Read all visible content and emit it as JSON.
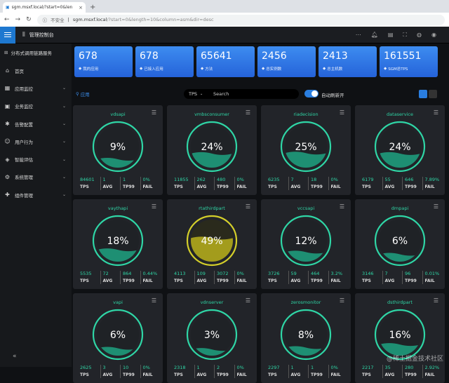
{
  "browser": {
    "tab_title": "sgm.msxf.local/?start=0&len",
    "security_label": "不安全",
    "address_host": "sgm.msxf.local",
    "address_query": "/?start=0&length=10&column=asm&dir=desc"
  },
  "header": {
    "title": "管理控制台"
  },
  "sidebar": {
    "title": "分布式调用链路服务",
    "items": [
      {
        "label": "首页",
        "icon": "home-icon",
        "has_children": false
      },
      {
        "label": "应用监控",
        "icon": "monitor-icon",
        "has_children": true
      },
      {
        "label": "业务监控",
        "icon": "business-icon",
        "has_children": true
      },
      {
        "label": "告警配置",
        "icon": "alarm-icon",
        "has_children": true
      },
      {
        "label": "用户行为",
        "icon": "user-icon",
        "has_children": true
      },
      {
        "label": "智能评估",
        "icon": "evaluate-icon",
        "has_children": true
      },
      {
        "label": "系统管理",
        "icon": "gear-icon",
        "has_children": true
      },
      {
        "label": "组件管理",
        "icon": "puzzle-icon",
        "has_children": true
      }
    ]
  },
  "stats": [
    {
      "value": "678",
      "label": "我的应用"
    },
    {
      "value": "678",
      "label": "已接入应用"
    },
    {
      "value": "65641",
      "label": "方法"
    },
    {
      "value": "2456",
      "label": "总实例数"
    },
    {
      "value": "2413",
      "label": "总主机数"
    },
    {
      "value": "161551",
      "label": "SGM总TPS"
    }
  ],
  "filter": {
    "location_label": "应用",
    "metric_select": "TPS",
    "search_placeholder": "Search",
    "auto_refresh_label": "自动刷新开",
    "auto_refresh_on": true
  },
  "metric_keys": [
    "TPS",
    "AVG",
    "TP99",
    "FAIL"
  ],
  "cards": [
    {
      "name": "vdsapi",
      "percent": "9%",
      "level": 0.09,
      "status": "normal",
      "tps": "84601",
      "avg": "1",
      "tp99": "1",
      "fail": "0%"
    },
    {
      "name": "vmbsconsumer",
      "percent": "24%",
      "level": 0.24,
      "status": "normal",
      "tps": "11855",
      "avg": "262",
      "tp99": "480",
      "fail": "0%"
    },
    {
      "name": "riadecision",
      "percent": "25%",
      "level": 0.25,
      "status": "normal",
      "tps": "6235",
      "avg": "7",
      "tp99": "18",
      "fail": "0%"
    },
    {
      "name": "dataservice",
      "percent": "24%",
      "level": 0.24,
      "status": "normal",
      "tps": "6179",
      "avg": "55",
      "tp99": "646",
      "fail": "7.89%"
    },
    {
      "name": "vaythapi",
      "percent": "18%",
      "level": 0.18,
      "status": "normal",
      "tps": "5535",
      "avg": "72",
      "tp99": "864",
      "fail": "0.44%"
    },
    {
      "name": "rtathirdpart",
      "percent": "49%",
      "level": 0.49,
      "status": "warning",
      "tps": "4113",
      "avg": "109",
      "tp99": "3072",
      "fail": "0%"
    },
    {
      "name": "vccsapi",
      "percent": "12%",
      "level": 0.12,
      "status": "normal",
      "tps": "3726",
      "avg": "59",
      "tp99": "464",
      "fail": "3.2%"
    },
    {
      "name": "dmpapi",
      "percent": "6%",
      "level": 0.06,
      "status": "normal",
      "tps": "3146",
      "avg": "7",
      "tp99": "96",
      "fail": "0.01%"
    },
    {
      "name": "vapi",
      "percent": "6%",
      "level": 0.06,
      "status": "normal",
      "tps": "2625",
      "avg": "3",
      "tp99": "10",
      "fail": "0%"
    },
    {
      "name": "vdnserver",
      "percent": "3%",
      "level": 0.03,
      "status": "normal",
      "tps": "2318",
      "avg": "1",
      "tp99": "2",
      "fail": "0%"
    },
    {
      "name": "zerosmonitor",
      "percent": "8%",
      "level": 0.08,
      "status": "normal",
      "tps": "2297",
      "avg": "1",
      "tp99": "1",
      "fail": "0%"
    },
    {
      "name": "dsthirdpart",
      "percent": "16%",
      "level": 0.16,
      "status": "normal",
      "tps": "2217",
      "avg": "35",
      "tp99": "280",
      "fail": "2.92%"
    }
  ],
  "colors": {
    "normal": "#2fd6a6",
    "warning": "#d4cf2a",
    "normal_fill": "#1e8f73",
    "warning_fill": "#a39c1c"
  },
  "watermark": "@稀土掘金技术社区"
}
